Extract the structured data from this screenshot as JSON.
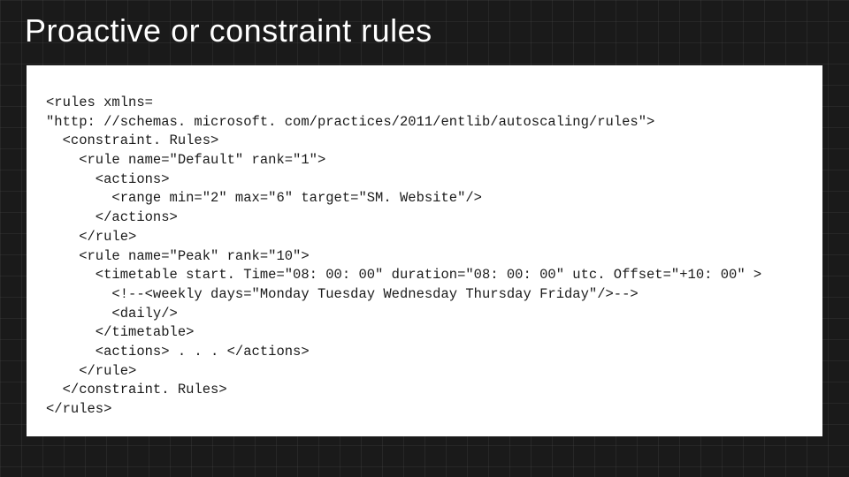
{
  "slide": {
    "title": "Proactive or constraint rules",
    "code": "<rules xmlns=\n\"http: //schemas. microsoft. com/practices/2011/entlib/autoscaling/rules\">\n  <constraint. Rules>\n    <rule name=\"Default\" rank=\"1\">\n      <actions>\n        <range min=\"2\" max=\"6\" target=\"SM. Website\"/>\n      </actions>\n    </rule>\n    <rule name=\"Peak\" rank=\"10\">\n      <timetable start. Time=\"08: 00: 00\" duration=\"08: 00: 00\" utc. Offset=\"+10: 00\" >\n        <!--<weekly days=\"Monday Tuesday Wednesday Thursday Friday\"/>-->\n        <daily/>\n      </timetable>\n      <actions> . . . </actions>\n    </rule>\n  </constraint. Rules>\n</rules>"
  }
}
